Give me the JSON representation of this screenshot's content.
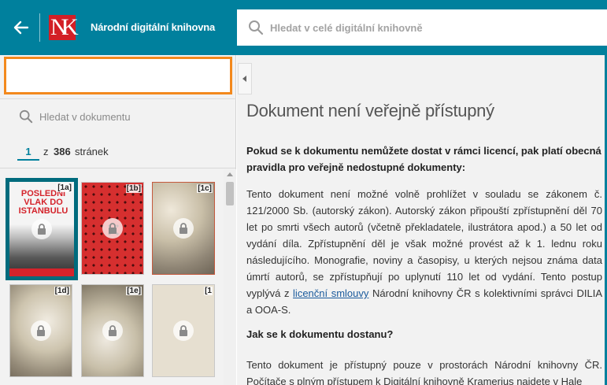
{
  "header": {
    "logo_n": "N",
    "logo_k": "K",
    "site_title": "Národní digitální knihovna",
    "search_placeholder": "Hledat v celé digitální knihovně"
  },
  "left_panel": {
    "doc_search_placeholder": "Hledat v dokumentu",
    "pager": {
      "current": "1",
      "of_word": "z",
      "total": "386",
      "unit": "stránek"
    },
    "thumbnails": [
      {
        "tag": "[1a]",
        "cover_title": "POSLEDNÍ VLAK DO ISTANBULU",
        "selected": true
      },
      {
        "tag": "[1b]",
        "selected": false
      },
      {
        "tag": "[1c]",
        "selected": false
      },
      {
        "tag": "[1d]",
        "selected": false
      },
      {
        "tag": "[1e]",
        "selected": false
      },
      {
        "tag": "[1",
        "selected": false
      }
    ]
  },
  "main": {
    "title": "Dokument není veřejně přístupný",
    "intro": "Pokud se k dokumentu nemůžete dostat v rámci licencí, pak platí obecná pravidla pro veřejně nedostupné dokumenty:",
    "para1_before": "Tento dokument není možné volně prohlížet v souladu se zákonem č. 121/2000 Sb. (autorský zákon). Autorský zákon připouští zpřístupnění děl 70 let po smrti všech autorů (včetně překladatele, ilustrátora apod.) a 50 let od vydání díla. Zpřístupnění děl je však možné provést až k 1. lednu roku následujícího. Monografie, noviny a časopisy, u kterých nejsou známa data úmrtí autorů, se zpřístupňují po uplynutí 110 let od vydání. Tento postup vyplývá z ",
    "para1_link": "licenční smlouvy",
    "para1_after": " Národní knihovny ČR s kolektivními správci DILIA a OOA-S.",
    "subhead": "Jak se k dokumentu dostanu?",
    "para2": "Tento dokument je přístupný pouze v prostorách Národní knihovny ČR. Počítače s plným přístupem k Digitální knihovně Kramerius najdete v Hale"
  },
  "colors": {
    "brand": "#00809d",
    "accent_orange": "#f3891d",
    "logo_red": "#d31f26"
  },
  "icons": [
    "arrow-left-icon",
    "search-icon",
    "lock-icon",
    "chevron-left-icon"
  ]
}
